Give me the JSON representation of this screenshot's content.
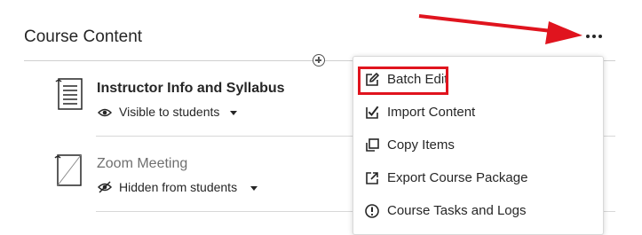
{
  "section": {
    "title": "Course Content"
  },
  "items": [
    {
      "title": "Instructor Info and Syllabus",
      "visibility": "Visible to students",
      "icon": "syllabus-document-icon"
    },
    {
      "title": "Zoom Meeting",
      "visibility": "Hidden from students",
      "icon": "blank-document-icon"
    }
  ],
  "menu": {
    "items": [
      {
        "label": "Batch Edit",
        "icon": "edit-pencil-icon"
      },
      {
        "label": "Import Content",
        "icon": "import-checkbox-icon"
      },
      {
        "label": "Copy Items",
        "icon": "copy-icon"
      },
      {
        "label": "Export Course Package",
        "icon": "export-icon"
      },
      {
        "label": "Course Tasks and Logs",
        "icon": "info-alert-icon"
      }
    ]
  },
  "colors": {
    "annotation": "#e0141e",
    "text": "#262626",
    "muted": "#6f6f6f"
  }
}
